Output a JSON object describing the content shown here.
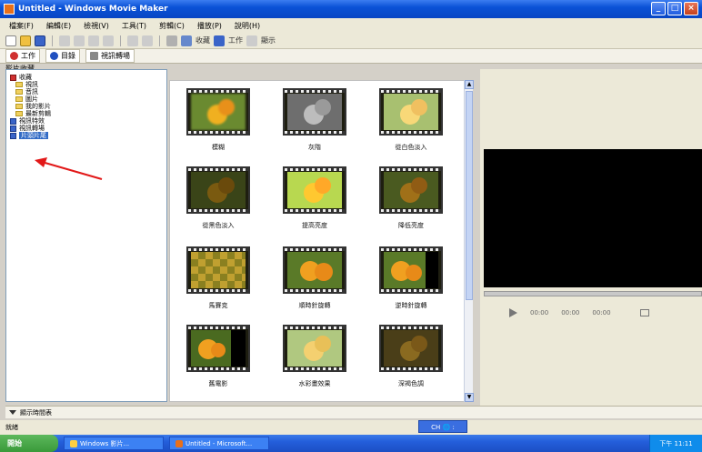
{
  "window": {
    "title": "Untitled - Windows Movie Maker",
    "controls": [
      "_",
      "□",
      "×"
    ]
  },
  "menu": [
    "檔案(F)",
    "編輯(E)",
    "檢視(V)",
    "工具(T)",
    "剪輯(C)",
    "播放(P)",
    "說明(H)"
  ],
  "toolbar": {
    "collections_label": "收藏",
    "tasks_label": "工作",
    "show_label": "顯示"
  },
  "tabs": [
    {
      "label": "工作"
    },
    {
      "label": "目錄"
    },
    {
      "label": "視訊轉場"
    }
  ],
  "left_panel": {
    "header": "影片收藏",
    "tree": [
      {
        "label": "收藏",
        "level": 0,
        "icon": "folder-icon"
      },
      {
        "label": "視訊",
        "level": 1,
        "icon": "folder-icon"
      },
      {
        "label": "音訊",
        "level": 1,
        "icon": "folder-icon"
      },
      {
        "label": "圖片",
        "level": 1,
        "icon": "folder-icon"
      },
      {
        "label": "我的影片",
        "level": 1,
        "icon": "folder-icon"
      },
      {
        "label": "最新剪輯",
        "level": 1,
        "icon": "folder-icon"
      },
      {
        "label": "視訊特效",
        "level": 0,
        "icon": "square-icon"
      },
      {
        "label": "視訊轉場",
        "level": 0,
        "icon": "square-icon"
      },
      {
        "label": "片頭片尾",
        "level": 0,
        "icon": "square-icon",
        "selected": true
      }
    ]
  },
  "effects": [
    {
      "caption": "模糊"
    },
    {
      "caption": "灰階"
    },
    {
      "caption": "從白色淡入"
    },
    {
      "caption": "從黑色淡入"
    },
    {
      "caption": "提高亮度"
    },
    {
      "caption": "降低亮度"
    },
    {
      "caption": "馬賽克"
    },
    {
      "caption": "順時針旋轉"
    },
    {
      "caption": "逆時針旋轉"
    },
    {
      "caption": "舊電影"
    },
    {
      "caption": "水彩畫效果"
    },
    {
      "caption": "深褐色調"
    }
  ],
  "preview": {
    "time_labels": [
      "00:00",
      "00:00",
      "00:00"
    ]
  },
  "storyboard": {
    "label": "顯示時間表"
  },
  "status": {
    "text": "就緒",
    "language_bar": "CH 🌐 :"
  },
  "taskbar": {
    "start_label": "開始",
    "items": [
      "Windows 影片...",
      "Untitled - Microsoft..."
    ],
    "clock": "下午 11:11"
  },
  "colors": {
    "title_blue": "#0a52d6",
    "selection": "#316ac5",
    "arrow_red": "#e21818"
  }
}
